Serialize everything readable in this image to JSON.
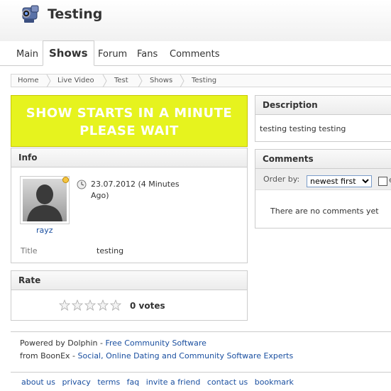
{
  "header": {
    "title": "Testing",
    "icon": "video-camera-icon"
  },
  "tabs": [
    {
      "label": "Main"
    },
    {
      "label": "Shows"
    },
    {
      "label": "Forum"
    },
    {
      "label": "Fans"
    },
    {
      "label": "Comments"
    }
  ],
  "breadcrumb": [
    "Home",
    "Live Video",
    "Test",
    "Shows",
    "Testing"
  ],
  "banner": {
    "line1": "SHOW STARTS IN A MINUTE",
    "line2": "PLEASE WAIT",
    "bg_color": "#e6f31e"
  },
  "info": {
    "heading": "Info",
    "author": "rayz",
    "date": "23.07.2012 (4 Minutes Ago)",
    "date_line1": "23.07.2012 (4 Minutes",
    "date_line2": "Ago)",
    "title_label": "Title",
    "title_value": "testing"
  },
  "rate": {
    "heading": "Rate",
    "votes": "0 votes",
    "stars": 0,
    "max_stars": 5
  },
  "description": {
    "heading": "Description",
    "text": "testing testing testing"
  },
  "comments": {
    "heading": "Comments",
    "order_label": "Order by:",
    "order_value": "newest first",
    "checkbox_label": "e",
    "empty_text": "There are no comments yet"
  },
  "footer": {
    "powered_prefix": "Powered by Dolphin - ",
    "powered_link": "Free Community Software",
    "from_prefix": "from BoonEx - ",
    "from_link": "Social, Online Dating and Community Software Experts",
    "links": [
      "about us",
      "privacy",
      "terms",
      "faq",
      "invite a friend",
      "contact us",
      "bookmark"
    ]
  }
}
